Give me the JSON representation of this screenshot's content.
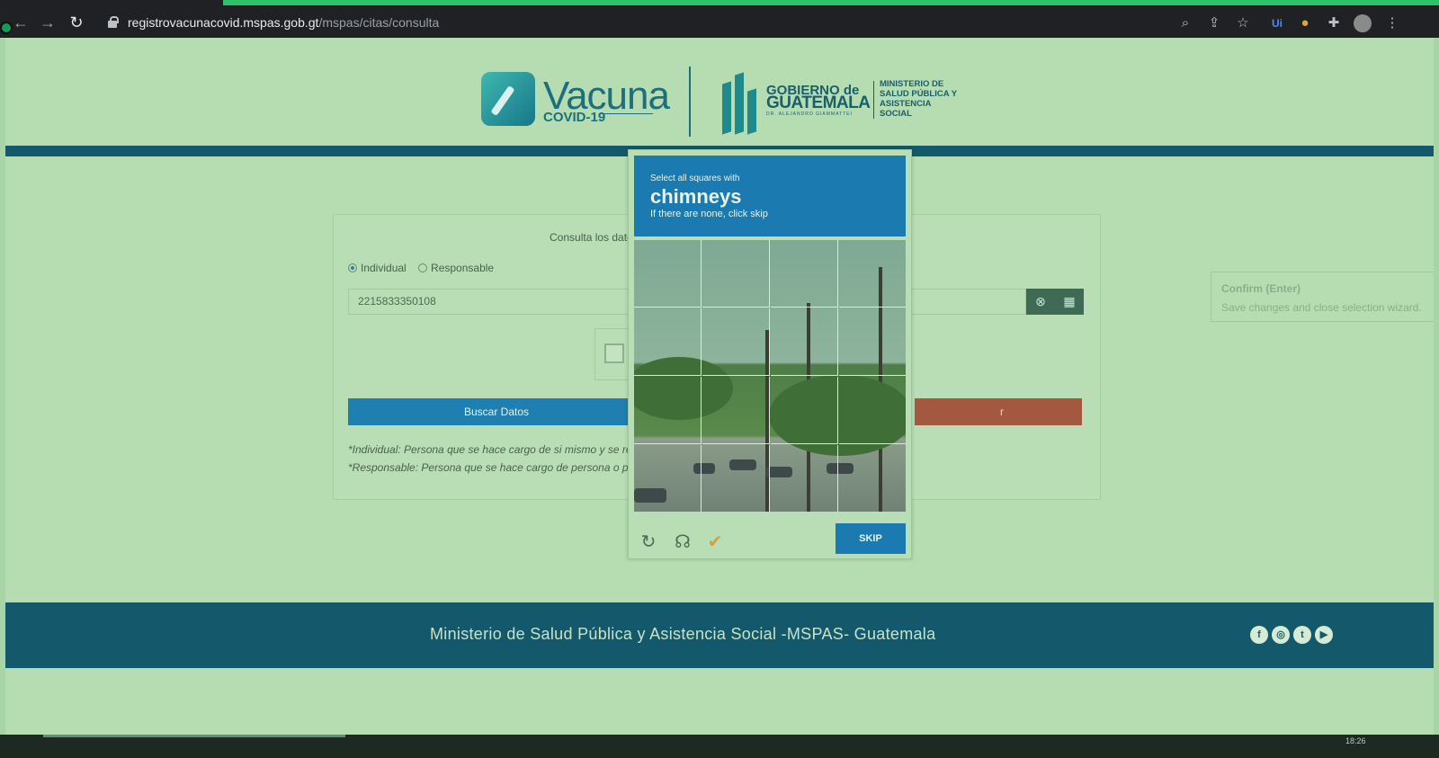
{
  "browser": {
    "url_host": "registrovacunacovid.mspas.gob.gt",
    "url_path": "/mspas/citas/consulta"
  },
  "header": {
    "vacuna_word": "Vacuna",
    "vacuna_sub": "COVID-19",
    "gob_line1": "GOBIERNO de",
    "gob_line2": "GUATEMALA",
    "gob_line3": "DR. ALEJANDRO GIAMMATTEI",
    "ministry": "MINISTERIO DE SALUD PÚBLICA Y ASISTENCIA SOCIAL"
  },
  "form": {
    "title": "Consulta los datos",
    "radio_individual": "Individual",
    "radio_responsable": "Responsable",
    "dpi_value": "2215833350108",
    "search_button": "Buscar Datos",
    "second_button_tail": "r",
    "note_individual": "*Individual: Persona que se hace cargo de si mismo y se regista",
    "note_responsable": "*Responsable: Persona que se hace cargo de persona o persor"
  },
  "captcha": {
    "prompt": "Select all squares with",
    "target": "chimneys",
    "hint": "If there are none, click skip",
    "skip_label": "SKIP",
    "icons": [
      "refresh-icon",
      "headphones-icon",
      "accessibility-user-icon"
    ]
  },
  "confirm_tooltip": {
    "title": "Confirm (Enter)",
    "desc": "Save changes and close selection wizard."
  },
  "footer": {
    "text": "Ministerio de Salud Pública y Asistencia Social -MSPAS- Guatemala",
    "social": [
      "facebook-icon",
      "instagram-icon",
      "twitter-icon",
      "youtube-icon"
    ]
  },
  "taskbar": {
    "clock": "18:26"
  }
}
